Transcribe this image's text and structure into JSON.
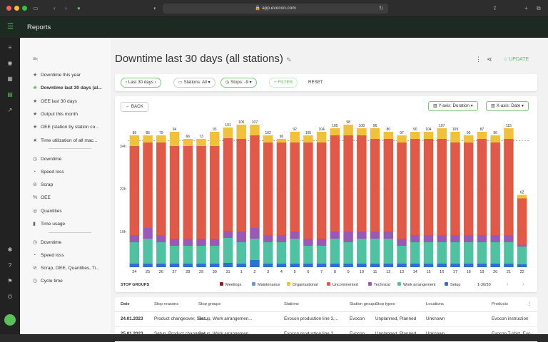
{
  "browser": {
    "url": "app.evocon.com"
  },
  "app": {
    "title": "Reports"
  },
  "sidebar": {
    "items": [
      {
        "label": "Downtime this year",
        "icon": "star-icon"
      },
      {
        "label": "Downtime last 30 days (al...",
        "icon": "star-icon"
      },
      {
        "label": "OEE last 30 days",
        "icon": "star-icon"
      },
      {
        "label": "Output this month",
        "icon": "star-icon"
      },
      {
        "label": "OEE (station by station co...",
        "icon": "star-icon"
      },
      {
        "label": "Time utilization of all mac...",
        "icon": "star-icon"
      },
      {
        "label": "Downtime",
        "icon": "clock-icon"
      },
      {
        "label": "Speed loss",
        "icon": "speed-icon"
      },
      {
        "label": "Scrap",
        "icon": "scrap-icon"
      },
      {
        "label": "OEE",
        "icon": "percent-icon"
      },
      {
        "label": "Quantities",
        "icon": "quantities-icon"
      },
      {
        "label": "Time usage",
        "icon": "bars-icon"
      },
      {
        "label": "Downtime",
        "icon": "clock-icon"
      },
      {
        "label": "Speed loss",
        "icon": "speed-icon"
      },
      {
        "label": "Scrap, OEE, Quantities, Ti...",
        "icon": "scrap-icon"
      },
      {
        "label": "Cycle time",
        "icon": "clock-icon"
      }
    ]
  },
  "page": {
    "title": "Downtime last 30 days (all stations)",
    "update_label": "UPDATE"
  },
  "filters": {
    "period": "Last 30 days",
    "stations": "Stations: All",
    "stops": "Stops: -9",
    "filter": "FILTER",
    "reset": "RESET"
  },
  "chart_controls": {
    "back": "BACK",
    "yaxis": "Y-axis: Duration",
    "xaxis": "X-axis: Date"
  },
  "chart_data": {
    "type": "bar",
    "categories": [
      "24",
      "25",
      "26",
      "27",
      "28",
      "29",
      "30",
      "31",
      "1",
      "2",
      "3",
      "4",
      "5",
      "6",
      "7",
      "8",
      "9",
      "10",
      "11",
      "12",
      "13",
      "14",
      "15",
      "16",
      "17",
      "18",
      "19",
      "20",
      "21",
      "22"
    ],
    "labels": [
      "89",
      "85",
      "79",
      "94",
      "66",
      "73",
      "93",
      "101",
      "106",
      "107",
      "102",
      "96",
      "92",
      "105",
      "104",
      "105",
      "98",
      "108",
      "96",
      "80",
      "97",
      "90",
      "104",
      "107",
      "109",
      "90",
      "87",
      "96",
      "115",
      "62"
    ],
    "ylabels": [
      "34h",
      "22h",
      "10h"
    ],
    "yticks": [
      34,
      22,
      10
    ],
    "ylim": [
      0,
      40
    ],
    "reference_line": 35.5,
    "legend_title": "STOP GROUPS",
    "page": "1-30/30",
    "colors": {
      "Meetings": "#8b1e1e",
      "Maintenance": "#5b9bd5",
      "Organisational": "#f0c23b",
      "Uncommented": "#e05a47",
      "Technical": "#9b59b6",
      "Work arrangement": "#4fc3a1",
      "Setup": "#2e6fd1"
    },
    "series": [
      {
        "name": "Setup",
        "values": [
          1,
          1,
          1,
          1,
          1,
          1,
          1,
          1.2,
          1,
          2,
          1,
          1,
          1,
          1,
          1,
          1,
          1,
          1,
          1,
          1,
          1,
          1,
          1,
          1,
          1,
          1,
          1,
          1,
          1,
          0.8
        ]
      },
      {
        "name": "Work arrangement",
        "values": [
          6,
          7,
          6,
          5,
          5,
          5,
          5,
          7,
          6,
          6,
          6,
          6,
          7,
          5,
          5,
          7,
          6,
          7,
          7,
          7,
          5,
          6,
          6,
          6,
          6,
          6,
          6,
          6,
          6,
          5
        ]
      },
      {
        "name": "Technical",
        "values": [
          2,
          3,
          2,
          2,
          2,
          2,
          2,
          2,
          3,
          3,
          2,
          2,
          2,
          2,
          2,
          2,
          3,
          2,
          2,
          2,
          2,
          2,
          2,
          2,
          2,
          2,
          2,
          2,
          2,
          0.5
        ]
      },
      {
        "name": "Uncommented",
        "values": [
          25,
          24,
          26,
          26,
          26,
          26,
          26,
          26,
          26,
          26,
          26,
          26,
          25,
          27,
          27,
          27,
          27,
          27,
          26,
          26,
          27,
          27,
          27,
          27,
          26,
          26,
          27,
          26,
          27,
          13
        ]
      },
      {
        "name": "Organisational",
        "values": [
          3,
          2,
          2,
          4,
          2,
          2,
          4,
          3,
          4,
          3,
          2,
          1,
          3,
          2,
          3,
          2,
          3,
          2,
          3,
          2,
          2,
          2,
          2,
          3,
          3,
          2,
          2,
          2,
          3,
          1
        ]
      },
      {
        "name": "Maintenance",
        "values": [
          0,
          0,
          0,
          0,
          0,
          0,
          0,
          0,
          0,
          0,
          0,
          0,
          0,
          0,
          0,
          0,
          0,
          0,
          0,
          0,
          0,
          0,
          0,
          0,
          0,
          0,
          0,
          0,
          0,
          0
        ]
      },
      {
        "name": "Meetings",
        "values": [
          0,
          0,
          0,
          0,
          0,
          0,
          0,
          0,
          0,
          0,
          0,
          0,
          0,
          0,
          0,
          0,
          0,
          0,
          0,
          0,
          0,
          0,
          0,
          0,
          0,
          0,
          0,
          0,
          0,
          0
        ]
      }
    ]
  },
  "table": {
    "columns": [
      "Date",
      "Stop reasons",
      "Stop groups",
      "Stations",
      "Station groups",
      "Stop types",
      "Locations",
      "Products"
    ],
    "rows": [
      [
        "24.01.2023",
        "Product changeover, Set...",
        "Setup, Work arrangemen...",
        "Evocon production line 3,...",
        "Evocon",
        "Unplanned, Planned",
        "Unknown",
        "Evocon instruction"
      ],
      [
        "25.01.2023",
        "Setup, Product changeov...",
        "Setup, Work arrangemen...",
        "Evocon production line 3,...",
        "Evocon",
        "Unplanned, Planned",
        "Unknown",
        "Evocon T-shirt, Evo..."
      ]
    ]
  }
}
